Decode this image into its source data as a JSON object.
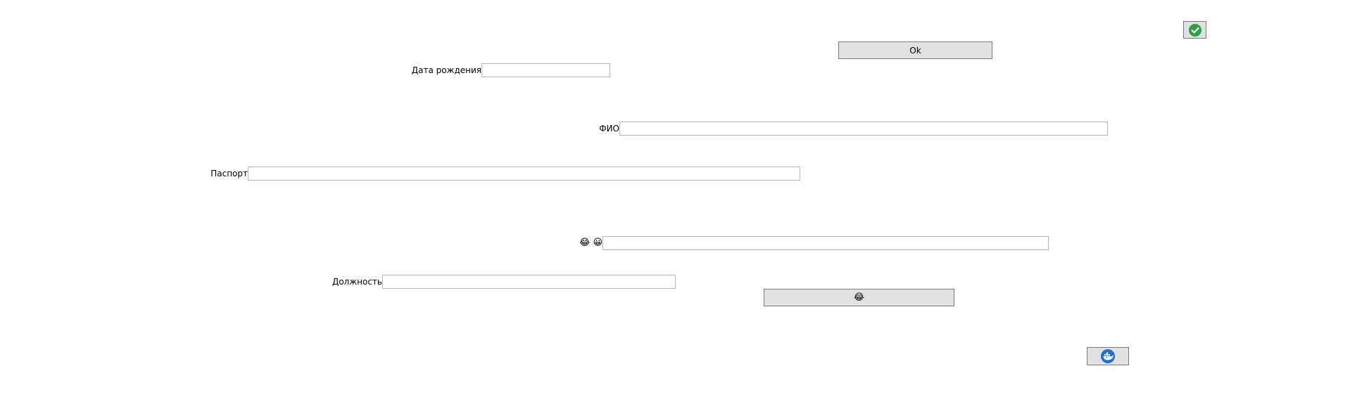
{
  "form": {
    "ok_button": {
      "label": "Ok"
    },
    "birth_date": {
      "label": "Дата рождения",
      "value": ""
    },
    "full_name": {
      "label": "ФИО",
      "value": ""
    },
    "passport": {
      "label": "Паспорт",
      "value": ""
    },
    "emoji_field": {
      "label": "😂 😀",
      "value": ""
    },
    "position": {
      "label": "Должность",
      "value": ""
    },
    "emoji_button": {
      "label": "😂"
    }
  },
  "icons": {
    "top_right_button": "check-circle-icon",
    "bottom_right_button": "docker-whale-icon"
  },
  "colors": {
    "button_bg": "#e1e1e1",
    "button_border": "#7a7a7a",
    "field_border": "#b4b4b4",
    "check_green": "#2ea043",
    "docker_blue": "#1d6fd6"
  }
}
